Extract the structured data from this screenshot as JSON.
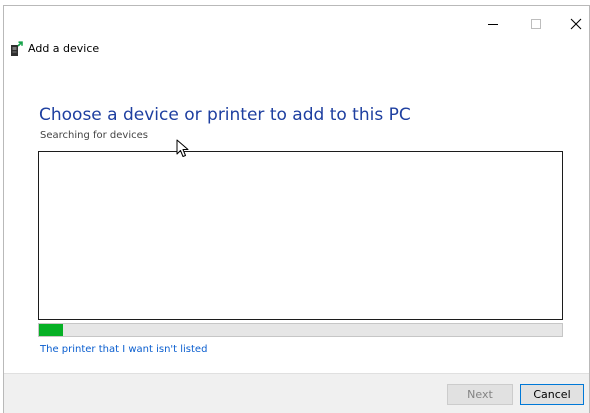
{
  "window": {
    "title": "Add a device",
    "icons": {
      "app": "add-device-icon",
      "minimize": "minimize-icon",
      "maximize": "maximize-icon",
      "close": "close-icon"
    }
  },
  "main": {
    "heading": "Choose a device or printer to add to this PC",
    "status": "Searching for devices",
    "progress_fraction": 0.045,
    "link": "The printer that I want isn't listed"
  },
  "footer": {
    "next_label": "Next",
    "cancel_label": "Cancel"
  },
  "colors": {
    "heading": "#1e3fa0",
    "link": "#0a5ecf",
    "progress": "#06b025",
    "focus": "#0078d7"
  }
}
